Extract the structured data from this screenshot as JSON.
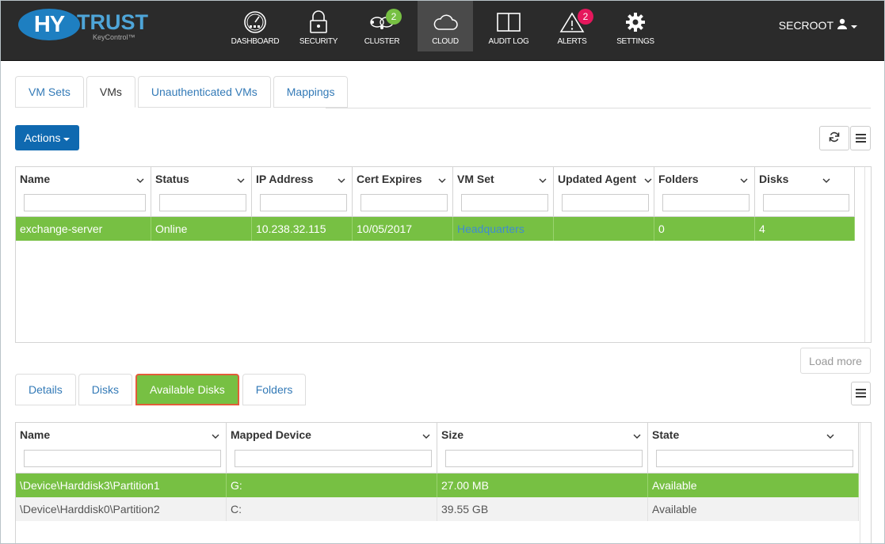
{
  "brand": {
    "name_part1": "HY",
    "name_part2": "TRUST",
    "subtitle": "KeyControl™"
  },
  "nav": [
    {
      "id": "dashboard",
      "label": "DASHBOARD",
      "icon": "speedometer-icon",
      "badge": null
    },
    {
      "id": "security",
      "label": "SECURITY",
      "icon": "lock-icon",
      "badge": null
    },
    {
      "id": "cluster",
      "label": "CLUSTER",
      "icon": "cluster-nodes-icon",
      "badge": "2",
      "badge_color": "#77c043"
    },
    {
      "id": "cloud",
      "label": "CLOUD",
      "icon": "cloud-icon",
      "badge": null,
      "active": true
    },
    {
      "id": "audit",
      "label": "AUDIT LOG",
      "icon": "book-icon",
      "badge": null
    },
    {
      "id": "alerts",
      "label": "ALERTS",
      "icon": "warning-icon",
      "badge": "2",
      "badge_color": "#e5175c"
    },
    {
      "id": "settings",
      "label": "SETTINGS",
      "icon": "gear-icon",
      "badge": null
    }
  ],
  "user": {
    "name": "SECROOT"
  },
  "main_tabs": [
    {
      "label": "VM Sets"
    },
    {
      "label": "VMs",
      "active": true
    },
    {
      "label": "Unauthenticated VMs"
    },
    {
      "label": "Mappings"
    }
  ],
  "toolbar": {
    "actions_label": "Actions"
  },
  "vm_grid": {
    "columns": [
      "Name",
      "Status",
      "IP Address",
      "Cert Expires",
      "VM Set",
      "Updated Agent",
      "Folders",
      "Disks"
    ],
    "rows": [
      {
        "cells": [
          "exchange-server",
          "Online",
          "10.238.32.115",
          "10/05/2017",
          "Headquarters",
          "",
          "0",
          "4"
        ],
        "selected": true
      }
    ]
  },
  "load_more_label": "Load more",
  "detail_tabs": [
    {
      "label": "Details"
    },
    {
      "label": "Disks"
    },
    {
      "label": "Available Disks",
      "active": true
    },
    {
      "label": "Folders"
    }
  ],
  "disk_grid": {
    "columns": [
      "Name",
      "Mapped Device",
      "Size",
      "State"
    ],
    "rows": [
      {
        "cells": [
          "\\Device\\Harddisk3\\Partition1",
          "G:",
          "27.00 MB",
          "Available"
        ],
        "selected": true
      },
      {
        "cells": [
          "\\Device\\Harddisk0\\Partition2",
          "C:",
          "39.55 GB",
          "Available"
        ],
        "selected": false
      }
    ]
  },
  "colors": {
    "selected_row": "#77c043",
    "primary_button": "#0f69b0",
    "link": "#337ab7"
  }
}
